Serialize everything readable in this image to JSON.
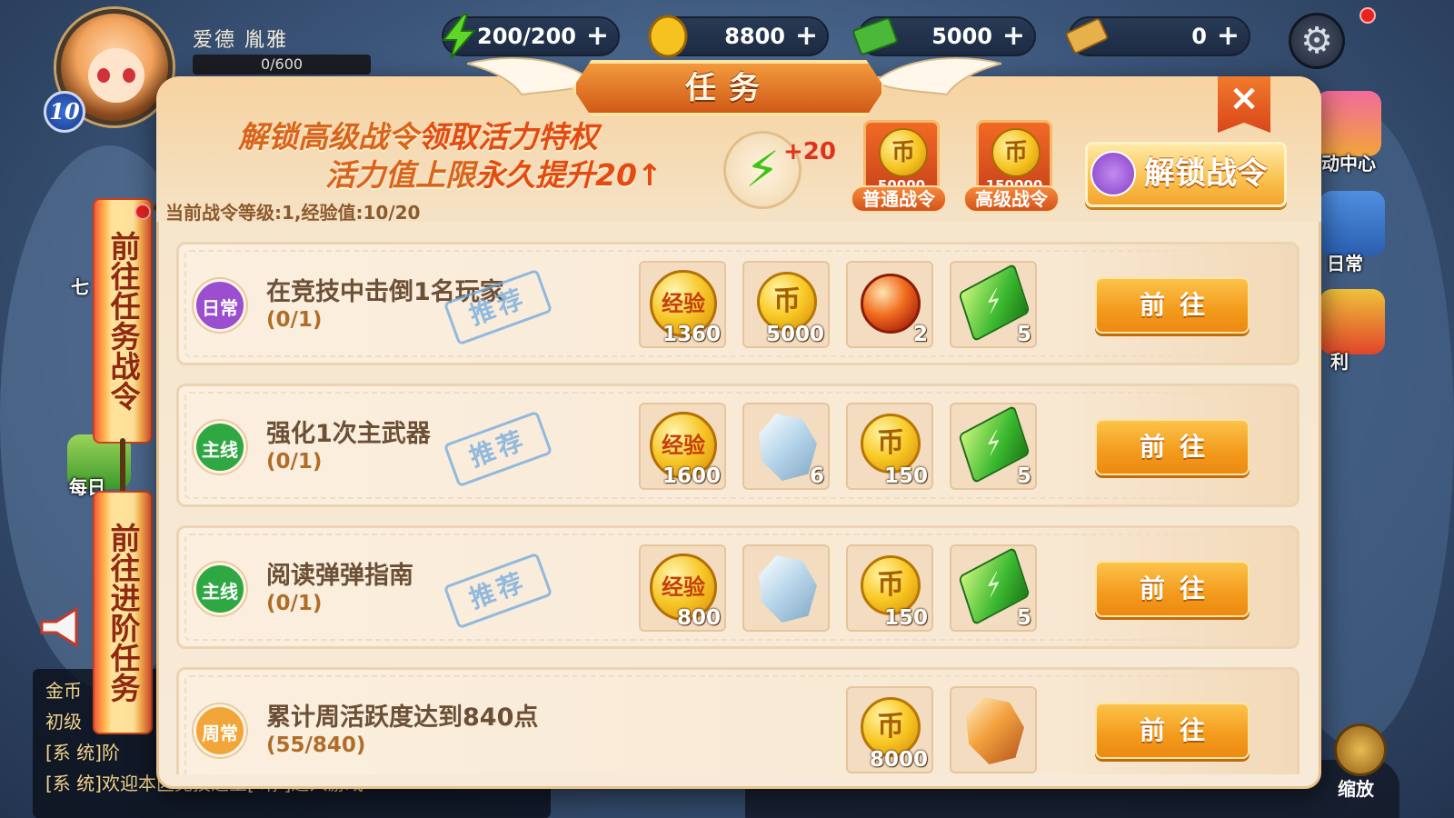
{
  "hud": {
    "player_name": "爱德  胤雅",
    "xp": "0/600",
    "level": "10",
    "energy": "200/200",
    "gold": "8800",
    "cash": "5000",
    "tickets": "0"
  },
  "sidebar": {
    "activity_center": "动中心",
    "daily": "日常",
    "benefits": "利",
    "daily_left": "每日",
    "seven": "七"
  },
  "tags": {
    "goto_battlepass_tasks": "前往任务战令",
    "goto_advanced_tasks": "前往进阶任务"
  },
  "dialog": {
    "title": "任务",
    "close": "×",
    "promo_line1_a": "解锁高级战令",
    "promo_line1_b": "领取活力特权",
    "promo_line2_a": "活力值上限",
    "promo_line2_b": "永久提升20",
    "energy_bonus": "+20",
    "normal_token_value": "50000",
    "normal_token_label": "普通战令",
    "premium_token_value": "150000",
    "premium_token_label": "高级战令",
    "unlock_button": "解锁战令",
    "progress_text": "当前战令等级:1,经验值:10/20"
  },
  "tasks": [
    {
      "type": "日常",
      "title": "在竞技中击倒1名玩家",
      "progress": "(0/1)",
      "recommend": "推荐",
      "rewards": [
        {
          "kind": "xp",
          "label": "经验",
          "amount": "1360"
        },
        {
          "kind": "coin",
          "label": "币",
          "amount": "5000"
        },
        {
          "kind": "orb",
          "amount": "2"
        },
        {
          "kind": "ticket",
          "amount": "5"
        }
      ],
      "button": "前往"
    },
    {
      "type": "主线",
      "title": "强化1次主武器",
      "progress": "(0/1)",
      "recommend": "推荐",
      "rewards": [
        {
          "kind": "xp",
          "label": "经验",
          "amount": "1600"
        },
        {
          "kind": "crystal",
          "amount": "6"
        },
        {
          "kind": "coin",
          "label": "币",
          "amount": "150"
        },
        {
          "kind": "ticket",
          "amount": "5"
        }
      ],
      "button": "前往"
    },
    {
      "type": "主线",
      "title": "阅读弹弹指南",
      "progress": "(0/1)",
      "recommend": "推荐",
      "rewards": [
        {
          "kind": "xp",
          "label": "经验",
          "amount": "800"
        },
        {
          "kind": "crystal",
          "amount": ""
        },
        {
          "kind": "coin",
          "label": "币",
          "amount": "150"
        },
        {
          "kind": "ticket",
          "amount": "5"
        }
      ],
      "button": "前往"
    },
    {
      "type": "周常",
      "title": "累计周活跃度达到840点",
      "progress": "(55/840)",
      "recommend": "",
      "rewards": [
        {
          "kind": "coin",
          "label": "币",
          "amount": "8000"
        },
        {
          "kind": "amber",
          "amount": ""
        }
      ],
      "button": "前往"
    }
  ],
  "chat": {
    "line1": "金币",
    "line2": "初级",
    "line3": "[系  统]阶",
    "line4": "[系  统]欢迎本区竞技之王[  晴  ]进入游戏"
  },
  "bottom_nav": {
    "zoom": "缩放"
  },
  "colors": {
    "daily_badge": "#9b4fd0",
    "main_badge": "#2fa843",
    "weekly_badge": "#f2a63a",
    "accent_orange": "#f39a1c"
  }
}
